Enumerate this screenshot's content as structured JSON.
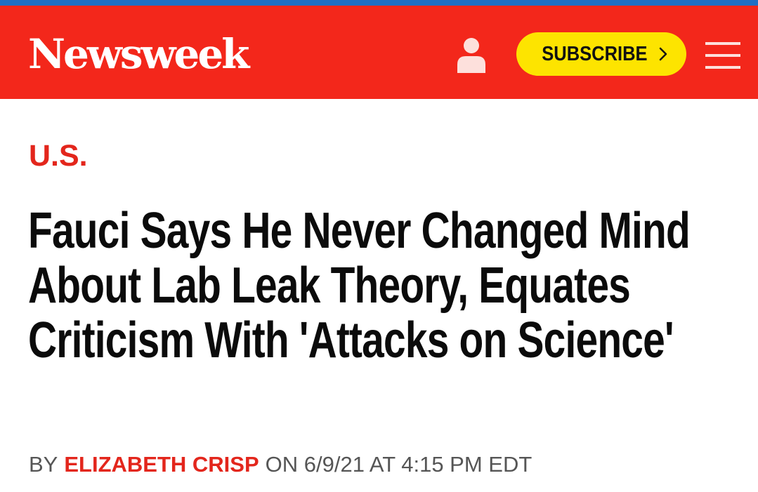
{
  "header": {
    "logo_text": "Newsweek",
    "account_icon": "user-icon",
    "subscribe_label": "SUBSCRIBE",
    "subscribe_icon": "chevron-right-icon",
    "menu_icon": "hamburger-menu-icon",
    "colors": {
      "top_strip": "#1f6fc4",
      "header_bg": "#f3271b",
      "subscribe_bg": "#fde400"
    }
  },
  "article": {
    "section": "U.S.",
    "headline": "Fauci Says He Never Changed Mind About Lab Leak Theory, Equates Criticism With 'Attacks on Science'",
    "byline": {
      "by_prefix": "BY",
      "author": "ELIZABETH CRISP",
      "date_text": "ON 6/9/21 AT 4:15 PM EDT"
    },
    "colors": {
      "section_and_author": "#e3261c",
      "headline": "#0b0b0b",
      "byline": "#555555"
    }
  }
}
